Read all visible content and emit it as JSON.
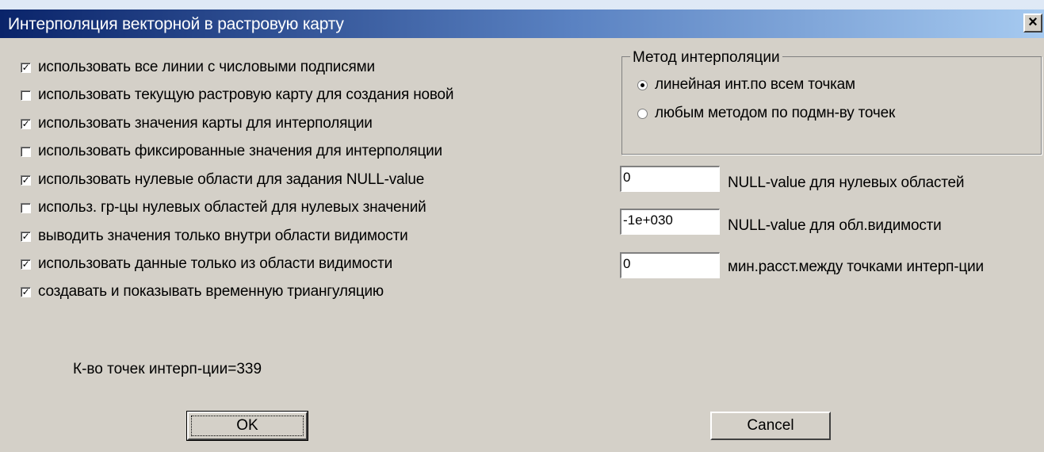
{
  "window": {
    "title": "Интерполяция векторной в растровую карту",
    "close_label": "×"
  },
  "options": [
    {
      "label": "использовать все линии с числовыми подписями",
      "checked": true
    },
    {
      "label": "использовать текущую растровую карту для создания новой",
      "checked": false
    },
    {
      "label": "использовать значения карты для интерполяции",
      "checked": true
    },
    {
      "label": "использовать фиксированные значения для интерполяции",
      "checked": false
    },
    {
      "label": "использовать нулевые области для задания NULL-value",
      "checked": true
    },
    {
      "label": "использ. гр-цы нулевых областей для нулевых значений",
      "checked": false
    },
    {
      "label": "выводить значения только внутри области видимости",
      "checked": true
    },
    {
      "label": "использовать данные только из области видимости",
      "checked": true
    },
    {
      "label": "создавать и показывать временную триангуляцию",
      "checked": true
    }
  ],
  "method": {
    "title": "Метод интерполяции",
    "options": [
      {
        "label": "линейная инт.по всем точкам",
        "selected": true
      },
      {
        "label": "любым методом по подмн-ву точек",
        "selected": false
      }
    ]
  },
  "fields": [
    {
      "value": "0",
      "label": "NULL-value для нулевых областей"
    },
    {
      "value": "-1e+030",
      "label": "NULL-value для обл.видимости"
    },
    {
      "value": "0",
      "label": "мин.расст.между точками интерп-ции"
    }
  ],
  "count_text": "К-во точек интерп-ции=339",
  "buttons": {
    "ok": "OK",
    "cancel": "Cancel"
  }
}
